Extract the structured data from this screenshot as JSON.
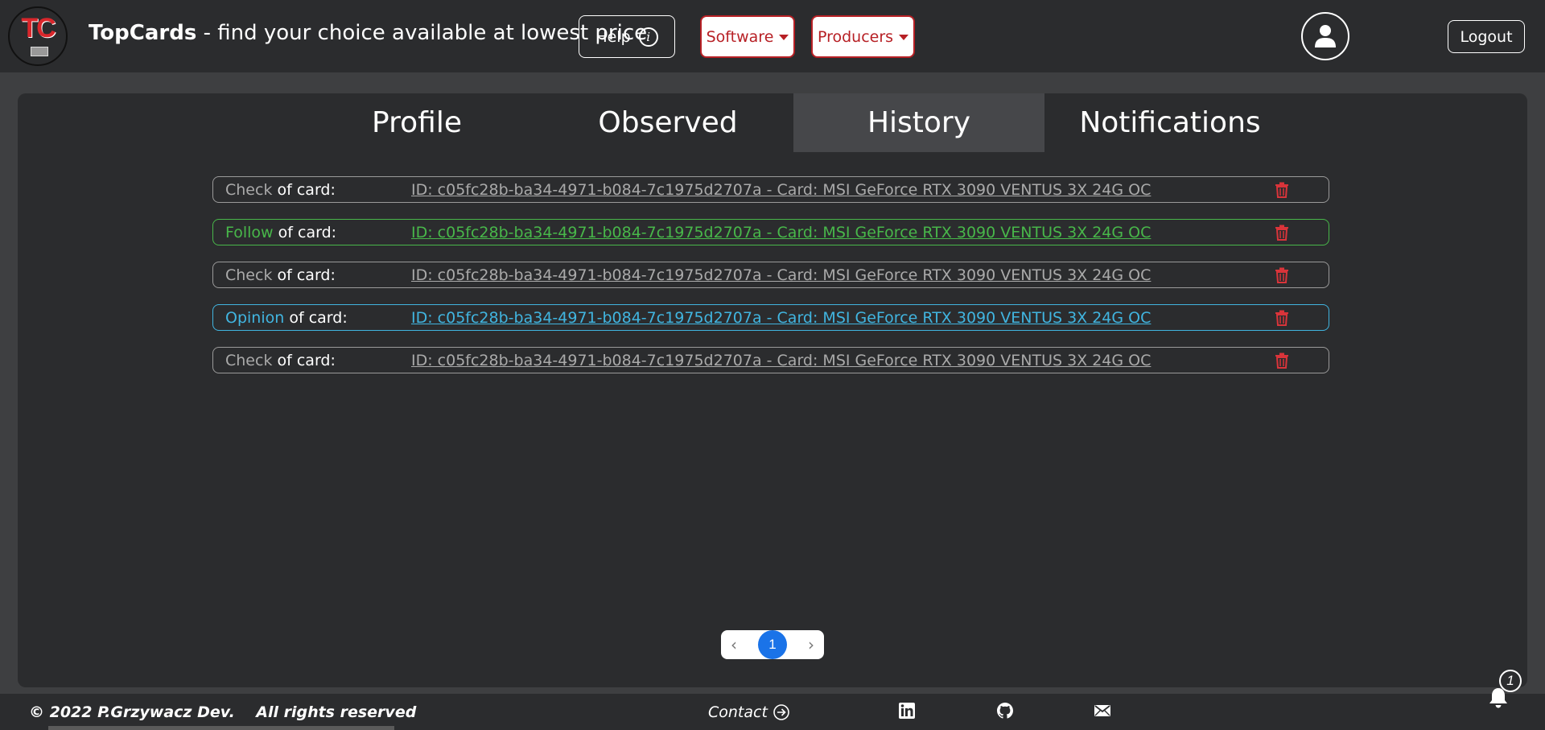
{
  "header": {
    "brand_name": "TopCards",
    "tagline": "- find your choice available at lowest price",
    "logo_text": "TC",
    "help_label": "Help",
    "software_label": "Software",
    "producers_label": "Producers",
    "logout_label": "Logout"
  },
  "tabs": [
    {
      "label": "Profile",
      "active": false
    },
    {
      "label": "Observed",
      "active": false
    },
    {
      "label": "History",
      "active": true
    },
    {
      "label": "Notifications",
      "active": false
    }
  ],
  "history": [
    {
      "kind": "Check",
      "suffix": "of card:",
      "link": "ID: c05fc28b-ba34-4971-b084-7c1975d2707a - Card: MSI GeForce RTX 3090 VENTUS 3X 24G OC"
    },
    {
      "kind": "Follow",
      "suffix": "of card:",
      "link": "ID: c05fc28b-ba34-4971-b084-7c1975d2707a - Card: MSI GeForce RTX 3090 VENTUS 3X 24G OC"
    },
    {
      "kind": "Check",
      "suffix": "of card:",
      "link": "ID: c05fc28b-ba34-4971-b084-7c1975d2707a - Card: MSI GeForce RTX 3090 VENTUS 3X 24G OC"
    },
    {
      "kind": "Opinion",
      "suffix": "of card:",
      "link": "ID: c05fc28b-ba34-4971-b084-7c1975d2707a - Card: MSI GeForce RTX 3090 VENTUS 3X 24G OC"
    },
    {
      "kind": "Check",
      "suffix": "of card:",
      "link": "ID: c05fc28b-ba34-4971-b084-7c1975d2707a - Card: MSI GeForce RTX 3090 VENTUS 3X 24G OC"
    }
  ],
  "pagination": {
    "prev": "‹",
    "current_page": "1",
    "next": "›"
  },
  "footer": {
    "copyright": "© 2022 P.Grzywacz Dev.    All rights reserved",
    "contact_label": "Contact",
    "notification_count": "1"
  },
  "colors": {
    "accent_red": "#b72025",
    "follow_green": "#48b74a",
    "opinion_blue": "#41b5e0",
    "page_blue": "#1a73e8",
    "trash_red": "#d9343a"
  },
  "icons": [
    "info-icon",
    "caret-down-icon",
    "user-icon",
    "trash-icon",
    "chevron-left-icon",
    "chevron-right-icon",
    "arrow-right-circle-icon",
    "linkedin-icon",
    "github-icon",
    "mail-icon",
    "bell-icon"
  ]
}
